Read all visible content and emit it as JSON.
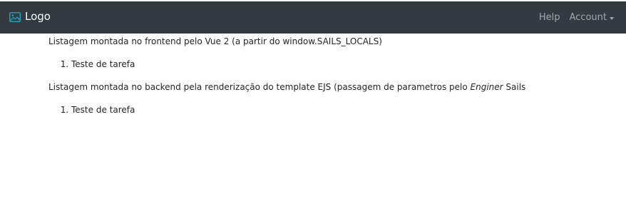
{
  "navbar": {
    "brand_icon": "image-icon",
    "brand_label": "Logo",
    "help_label": "Help",
    "account_label": "Account",
    "account_icon": "caret-down-icon",
    "background_color": "#343a40",
    "brand_icon_color": "#17a2b8"
  },
  "main": {
    "frontend_heading": "Listagem montada no frontend pelo Vue 2 (a partir do window.SAILS_LOCALS)",
    "frontend_tasks": [
      "Teste de tarefa"
    ],
    "backend_heading_prefix": "Listagem montada no backend pela renderização do template EJS (passagem de parametros pelo ",
    "backend_heading_emphasis": "Enginer",
    "backend_heading_suffix": " Sails",
    "backend_tasks": [
      "Teste de tarefa"
    ]
  }
}
